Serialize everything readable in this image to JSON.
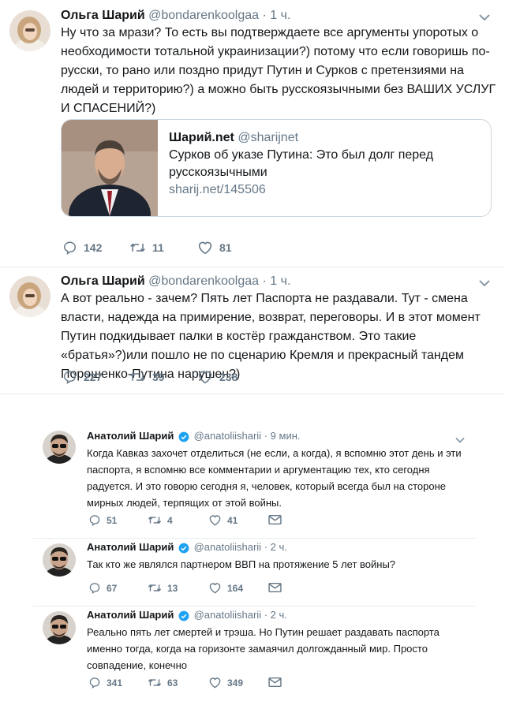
{
  "colors": {
    "text": "#14171a",
    "muted": "#657786",
    "verified": "#1da1f2",
    "border": "#e6ecf0"
  },
  "tweets_top": [
    {
      "author_name": "Ольга Шарий",
      "handle": "@bondarenkoolgaa",
      "time": "1 ч.",
      "text": "Ну что за мрази? То есть вы подтверждаете все аргументы упоротых о необходимости тотальной украинизации?) потому что если говоришь по-русски, то рано или поздно придут Путин и Сурков с претензиями на людей и территорию?) а можно быть русскоязычными без ВАШИХ УСЛУГ И СПАСЕНИЙ?)",
      "card": {
        "site_name": "Шарий.net",
        "site_handle": "@sharijnet",
        "title": "Сурков об указе Путина: Это был долг перед русскоязычными",
        "url": "sharij.net/145506"
      },
      "replies": "142",
      "retweets": "11",
      "likes": "81"
    },
    {
      "author_name": "Ольга Шарий",
      "handle": "@bondarenkoolgaa",
      "time": "1 ч.",
      "text": "А вот реально - зачем? Пять лет Паспорта не раздавали. Тут - смена власти, надежда на примирение, возврат, переговоры. И в этот момент Путин подкидывает палки в костёр гражданством. Это такие «братья»?)или пошло не по сценарию Кремля и прекрасный тандем Порошенко-Путина нарушен?)",
      "replies": "227",
      "retweets": "39",
      "likes": "238"
    }
  ],
  "tweets_bottom": [
    {
      "author_name": "Анатолий Шарий",
      "handle": "@anatoliisharii",
      "time": "9 мин.",
      "text": "Когда Кавказ захочет отделиться (не если, а когда), я вспомню этот день и эти паспорта, я вспомню все комментарии и аргументацию тех, кто сегодня радуется. И это говорю сегодня я, человек, который всегда был на стороне мирных людей, терпящих от этой войны.",
      "replies": "51",
      "retweets": "4",
      "likes": "41"
    },
    {
      "author_name": "Анатолий Шарий",
      "handle": "@anatoliisharii",
      "time": "2 ч.",
      "text": "Так кто же являлся партнером ВВП на протяжение 5 лет войны?",
      "replies": "67",
      "retweets": "13",
      "likes": "164"
    },
    {
      "author_name": "Анатолий Шарий",
      "handle": "@anatoliisharii",
      "time": "2 ч.",
      "text": "Реально пять лет смертей и трэша. Но Путин решает раздавать паспорта именно тогда, когда на горизонте замаячил долгожданный мир. Просто совпадение, конечно",
      "replies": "341",
      "retweets": "63",
      "likes": "349"
    }
  ],
  "icons": {
    "reply": "reply-icon",
    "retweet": "retweet-icon",
    "like": "heart-icon",
    "dm": "envelope-icon",
    "chevron": "chevron-down-icon",
    "verified": "verified-badge-icon"
  }
}
